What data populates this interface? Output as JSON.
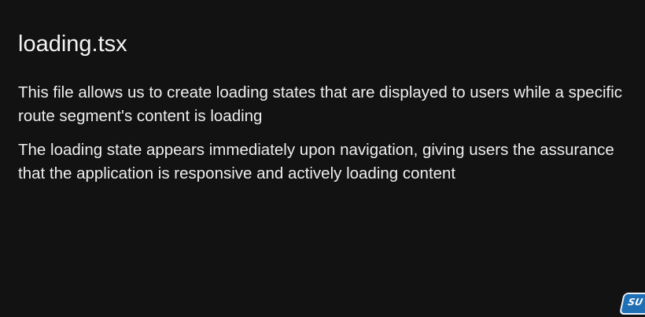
{
  "slide": {
    "title": "loading.tsx",
    "paragraphs": [
      "This file allows us to create loading states that are displayed to users while a specific route segment's content is loading",
      "The loading state appears immediately upon navigation, giving users the assurance that the application is responsive and actively loading content"
    ]
  },
  "badge": {
    "text": "SU",
    "color": "#1f6fb5"
  },
  "colors": {
    "background": "#121212",
    "text": "#eeeeee"
  }
}
